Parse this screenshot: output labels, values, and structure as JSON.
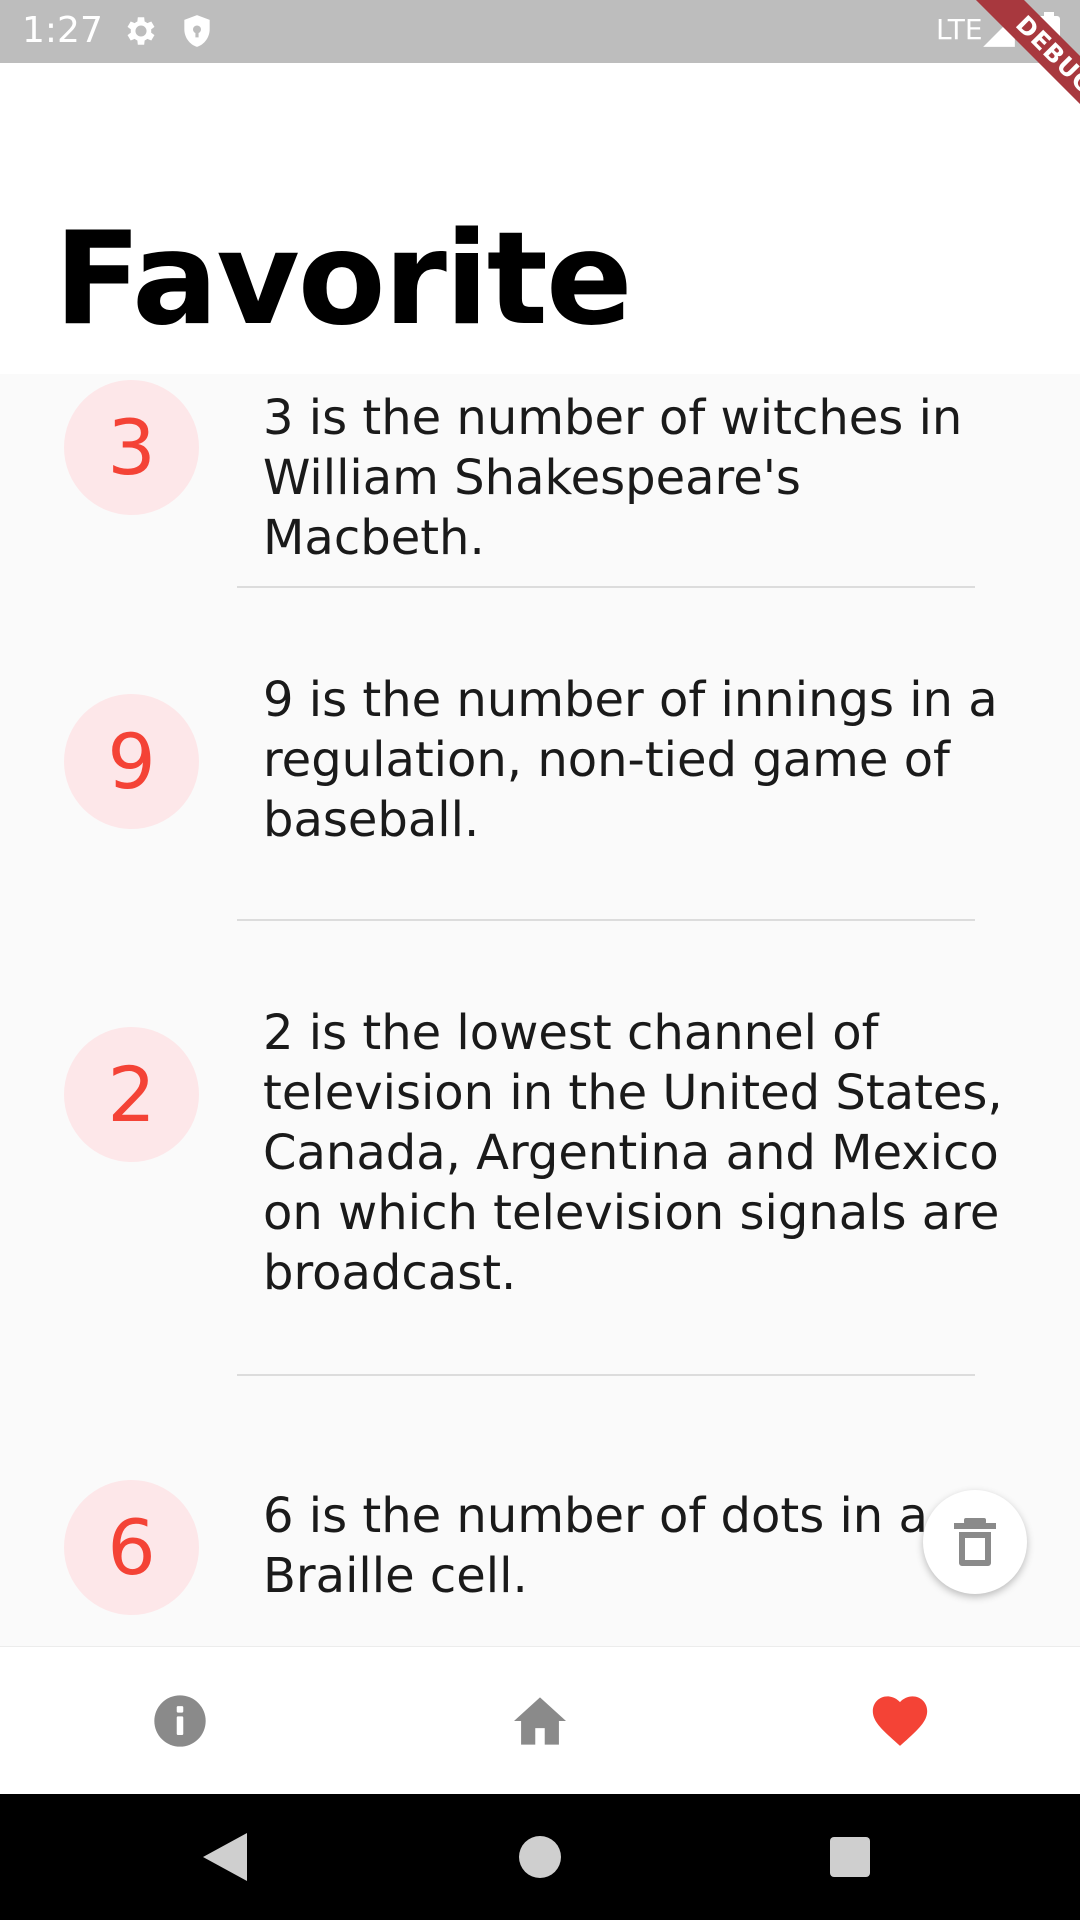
{
  "status_bar": {
    "time": "1:27",
    "network": "LTE",
    "icons": [
      "gear-icon",
      "shield-icon",
      "signal-icon",
      "battery-icon"
    ]
  },
  "debug_banner": "DEBUG",
  "header": {
    "title": "Favorite"
  },
  "favorites": [
    {
      "number": "3",
      "text": "3 is the number of witches in William Shakespeare's Macbeth."
    },
    {
      "number": "9",
      "text": "9 is the number of innings in a regulation, non-tied game of baseball."
    },
    {
      "number": "2",
      "text": "2 is the lowest channel of television in the United States, Canada, Argentina and Mexico on which television signals are broadcast."
    },
    {
      "number": "6",
      "text": "6 is the number of dots in a Braille cell."
    }
  ],
  "fab": {
    "icon": "trash-icon"
  },
  "bottom_nav": {
    "items": [
      {
        "icon": "info-icon",
        "active": false
      },
      {
        "icon": "home-icon",
        "active": false
      },
      {
        "icon": "heart-icon",
        "active": true
      }
    ],
    "active_color": "#f44336",
    "inactive_color": "#8a8a8a"
  },
  "colors": {
    "accent": "#f44336",
    "avatar_bg": "#fde7e9",
    "status_bar": "#bdbdbd",
    "list_bg": "#fafafa"
  }
}
